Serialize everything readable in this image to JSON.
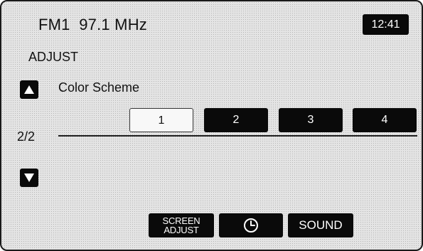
{
  "header": {
    "source_band": "FM1",
    "frequency": "97.1 MHz",
    "clock": "12:41"
  },
  "menu": {
    "title": "ADJUST",
    "setting_label": "Color Scheme",
    "page_indicator": "2/2",
    "up_icon": "triangle-up-icon",
    "down_icon": "triangle-down-icon"
  },
  "color_scheme": {
    "options": [
      "1",
      "2",
      "3",
      "4"
    ],
    "selected": "1"
  },
  "bottom_bar": {
    "screen_adjust_line1": "SCREEN",
    "screen_adjust_line2": "ADJUST",
    "clock_icon": "clock-icon",
    "sound_label": "SOUND"
  },
  "colors": {
    "button_bg": "#0a0a0a",
    "button_text": "#ffffff",
    "screen_bg": "#e4e4e4"
  }
}
